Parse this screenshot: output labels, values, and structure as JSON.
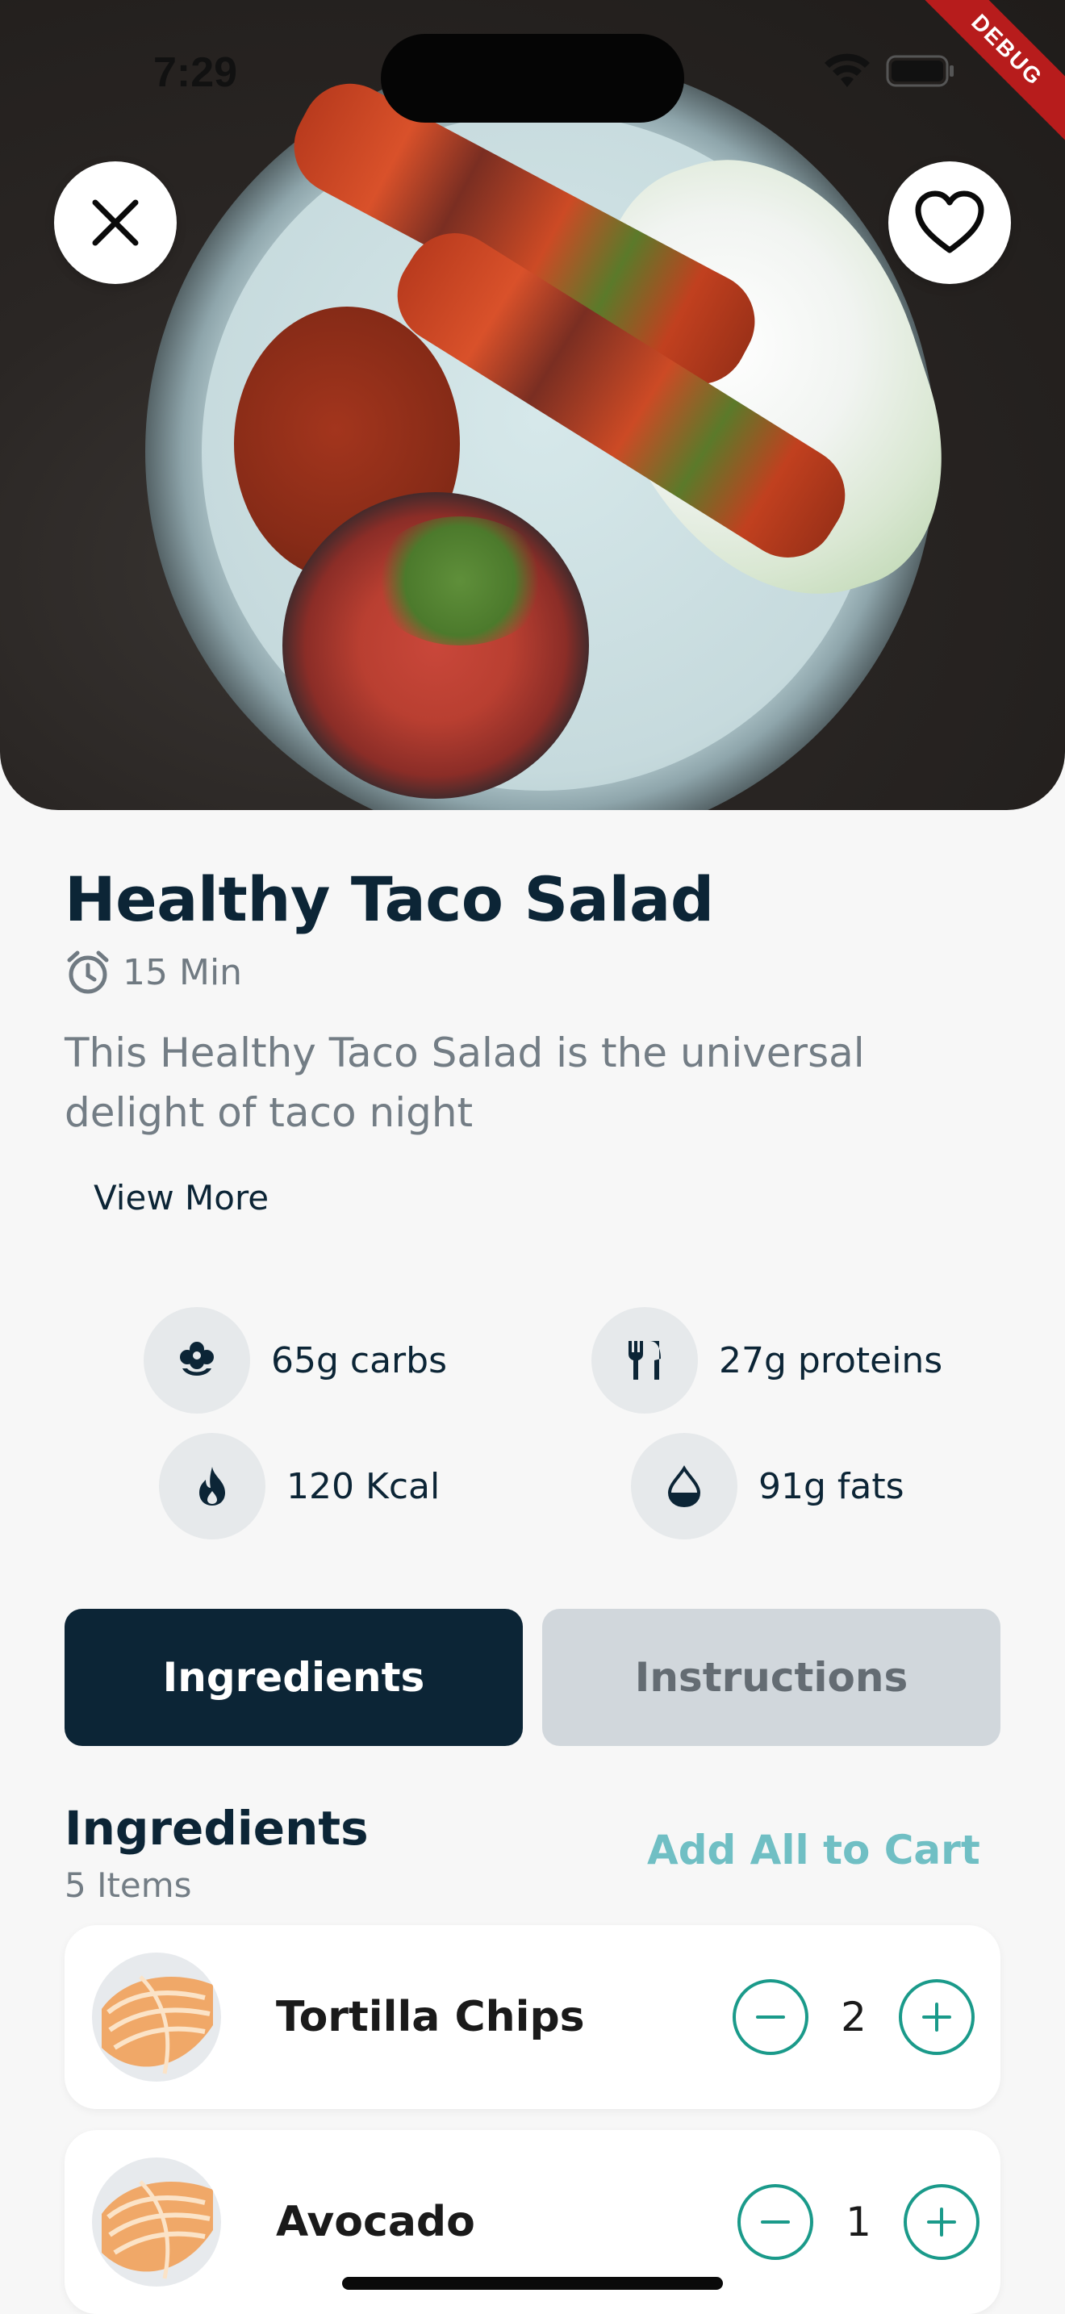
{
  "status_bar": {
    "time": "7:29",
    "debug_label": "DEBUG"
  },
  "recipe": {
    "title": "Healthy Taco Salad",
    "time": "15 Min",
    "description": "This Healthy Taco Salad is the universal delight of taco night",
    "view_more": "View More"
  },
  "nutrition": [
    {
      "label": "65g carbs",
      "icon": "carbs-icon"
    },
    {
      "label": "27g proteins",
      "icon": "fork-knife-icon"
    },
    {
      "label": "120 Kcal",
      "icon": "flame-icon"
    },
    {
      "label": "91g fats",
      "icon": "drop-icon"
    }
  ],
  "tabs": [
    {
      "label": "Ingredients",
      "active": true
    },
    {
      "label": "Instructions",
      "active": false
    }
  ],
  "ingredients_section": {
    "title": "Ingredients",
    "count": "5 Items",
    "add_all": "Add All to Cart",
    "items": [
      {
        "name": "Tortilla Chips",
        "quantity": "2"
      },
      {
        "name": "Avocado",
        "quantity": "1"
      }
    ]
  },
  "colors": {
    "primary": "#0c2536",
    "accent_teal": "#1a9a8a",
    "link_teal": "#70bfc4",
    "background": "#f7f7f7"
  }
}
